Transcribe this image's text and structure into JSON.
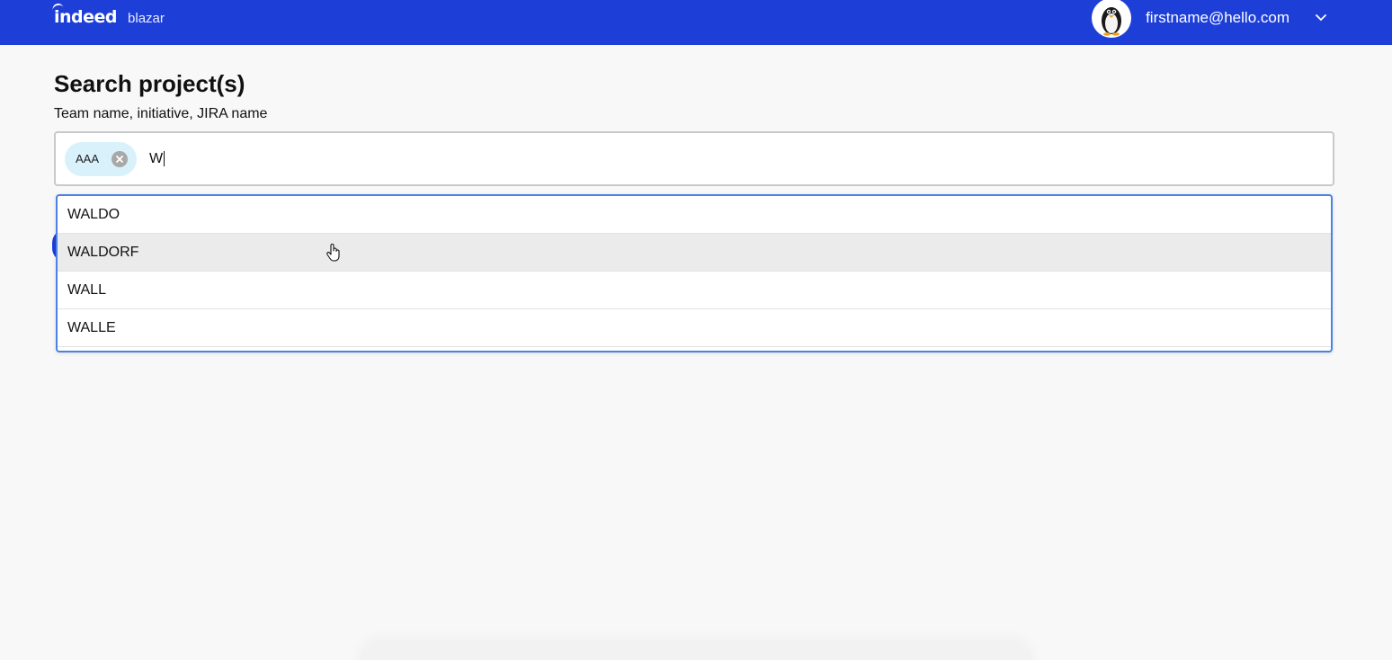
{
  "header": {
    "brand": "indeed",
    "product": "blazar",
    "user_email": "firstname@hello.com",
    "bar_color": "#1d3fd8",
    "avatar_icon": "penguin-icon",
    "menu_icon": "chevron-down-icon"
  },
  "search": {
    "title": "Search project(s)",
    "label": "Team name, initiative, JIRA name",
    "chips": [
      {
        "label": "AAA",
        "remove_icon": "clear-circle-icon"
      }
    ],
    "query": "W"
  },
  "dropdown": {
    "options": [
      {
        "label": "WALDO"
      },
      {
        "label": "WALDORF",
        "hovered": true
      },
      {
        "label": "WALL"
      },
      {
        "label": "WALLE"
      }
    ]
  }
}
